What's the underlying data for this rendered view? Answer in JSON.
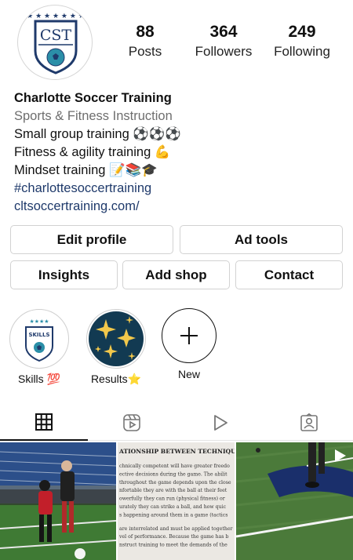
{
  "profile": {
    "avatar_text": "CST",
    "stats": {
      "posts": {
        "value": "88",
        "label": "Posts"
      },
      "followers": {
        "value": "364",
        "label": "Followers"
      },
      "following": {
        "value": "249",
        "label": "Following"
      }
    },
    "name": "Charlotte Soccer Training",
    "category": "Sports & Fitness Instruction",
    "bio_lines": [
      "Small group training ⚽⚽⚽",
      "Fitness & agility training 💪",
      "Mindset training  📝📚🎓"
    ],
    "hashtag": "#charlottesoccertraining",
    "website": "cltsoccertraining.com/"
  },
  "buttons": {
    "edit_profile": "Edit profile",
    "ad_tools": "Ad tools",
    "insights": "Insights",
    "add_shop": "Add shop",
    "contact": "Contact"
  },
  "highlights": [
    {
      "label": "Skills 💯",
      "badge_text": "SKILLS"
    },
    {
      "label": "Results⭐"
    },
    {
      "label": "New"
    }
  ],
  "tabs": [
    "grid-icon",
    "reels-icon",
    "video-icon",
    "tagged-icon"
  ],
  "posts": [
    {
      "kind": "photo"
    },
    {
      "kind": "text",
      "heading": "ATIONSHIP BETWEEN TECHNIQUE",
      "lines": [
        "chnically competent will have greater freedo",
        "ective decisions during the game. The abilit",
        "throughout the game depends upon the close",
        "nfortable they are with the ball at their feet",
        "owerfully they can run (physical fitness) or",
        "urately they can strike a ball, and how quic",
        "s happening around them in a game (tactics",
        "",
        "are interrelated and must be applied together",
        "vel of performance. Because the game has b",
        "nstruct training to meet the demands of the"
      ]
    },
    {
      "kind": "photo"
    }
  ],
  "colors": {
    "navy": "#1f3a6b",
    "teal": "#2b8fa8",
    "grey_text": "#6e6e6e"
  }
}
